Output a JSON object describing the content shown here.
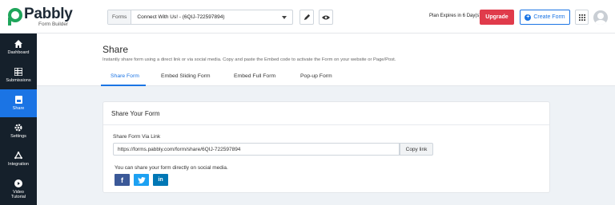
{
  "brand": {
    "name": "Pabbly",
    "sub": "Form Builder",
    "color": "#1fa55b"
  },
  "topbar": {
    "forms_label": "Forms",
    "selected_form": "Connect With Us! - (6QIJ-722597894)",
    "plan_text": "Plan Expires in 6 Day(s)",
    "upgrade_label": "Upgrade",
    "create_label": "Create Form"
  },
  "sidebar": {
    "items": [
      {
        "label": "Dashboard",
        "icon": "home-icon"
      },
      {
        "label": "Submissions",
        "icon": "table-icon"
      },
      {
        "label": "Share",
        "icon": "share-icon",
        "active": true
      },
      {
        "label": "Settings",
        "icon": "gear-icon"
      },
      {
        "label": "Integration",
        "icon": "integration-icon"
      },
      {
        "label": "Video Tutorial",
        "label_line1": "Video",
        "label_line2": "Tutorial",
        "icon": "play-icon"
      }
    ]
  },
  "page": {
    "title": "Share",
    "description": "Instantly share form using a direct link or via social media. Copy and paste the Embed code to activate the Form on your website or Page/Post.",
    "tabs": [
      "Share Form",
      "Embed Sliding Form",
      "Embed Full Form",
      "Pop-up Form"
    ],
    "active_tab": "Share Form"
  },
  "card": {
    "title": "Share Your Form",
    "field_label": "Share Form Via Link",
    "link_value": "https://forms.pabbly.com/form/share/6QIJ-722597894",
    "copy_label": "Copy link",
    "social_note": "You can share your form directly on social media.",
    "social": {
      "facebook": "f",
      "twitter": "twitter-icon",
      "linkedin": "in"
    }
  },
  "colors": {
    "accent": "#1b74e4",
    "upgrade": "#e03b4b",
    "sidebar": "#15202b"
  }
}
